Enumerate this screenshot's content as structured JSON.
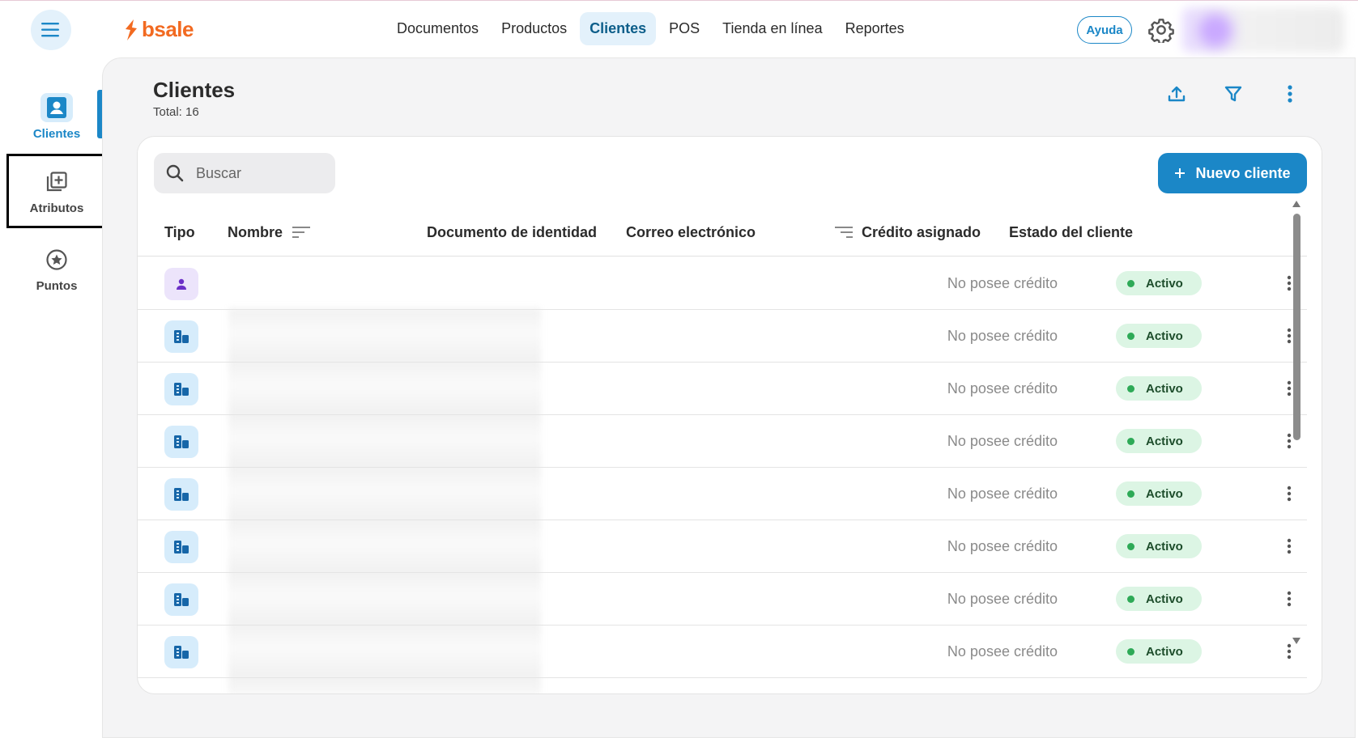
{
  "header": {
    "logo_text": "bsale",
    "nav": [
      "Documentos",
      "Productos",
      "Clientes",
      "POS",
      "Tienda en línea",
      "Reportes"
    ],
    "active_nav": "Clientes",
    "help_label": "Ayuda"
  },
  "sidebar": {
    "items": [
      {
        "label": "Clientes",
        "icon": "contact-card-icon",
        "active": true
      },
      {
        "label": "Atributos",
        "icon": "add-library-icon",
        "active": false
      },
      {
        "label": "Puntos",
        "icon": "star-circle-icon",
        "active": false
      }
    ]
  },
  "page": {
    "title": "Clientes",
    "total": "Total: 16"
  },
  "toolbar": {
    "search_placeholder": "Buscar",
    "new_button": "Nuevo cliente"
  },
  "table": {
    "columns": [
      "Tipo",
      "Nombre",
      "Documento de identidad",
      "Correo electrónico",
      "Crédito asignado",
      "Estado del cliente"
    ],
    "rows": [
      {
        "type": "person",
        "credit": "No posee crédito",
        "status": "Activo"
      },
      {
        "type": "company",
        "credit": "No posee crédito",
        "status": "Activo"
      },
      {
        "type": "company",
        "credit": "No posee crédito",
        "status": "Activo"
      },
      {
        "type": "company",
        "credit": "No posee crédito",
        "status": "Activo"
      },
      {
        "type": "company",
        "credit": "No posee crédito",
        "status": "Activo"
      },
      {
        "type": "company",
        "credit": "No posee crédito",
        "status": "Activo"
      },
      {
        "type": "company",
        "credit": "No posee crédito",
        "status": "Activo"
      },
      {
        "type": "company",
        "credit": "No posee crédito",
        "status": "Activo"
      }
    ]
  },
  "colors": {
    "brand_orange": "#f26a21",
    "accent_blue": "#1b87c7",
    "status_green": "#2eaa57"
  }
}
